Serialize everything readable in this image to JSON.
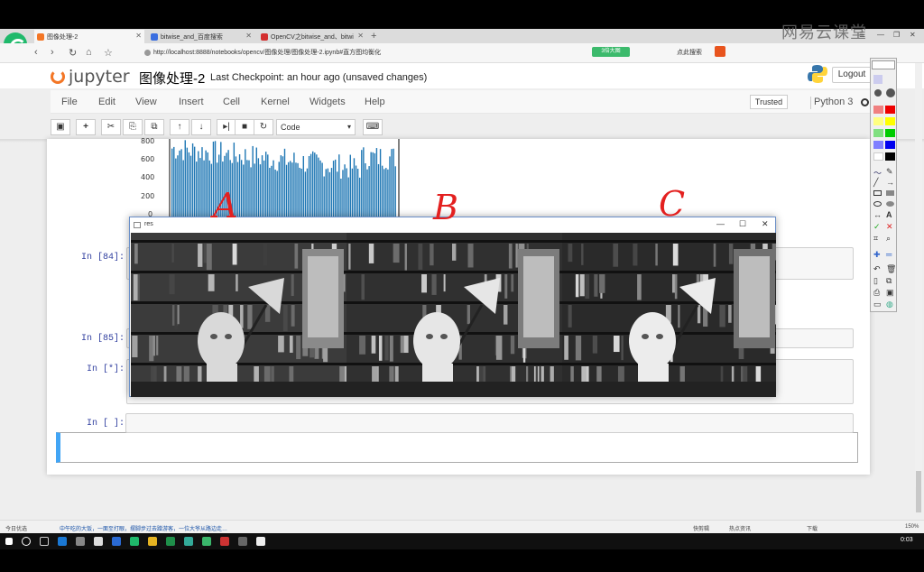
{
  "browser": {
    "tabs": [
      {
        "label": "图像处理-2",
        "active": true
      },
      {
        "label": "bitwise_and_百度搜索",
        "active": false
      },
      {
        "label": "OpenCV之bitwise_and、bitwi",
        "active": false
      }
    ],
    "url": "http://localhost:8888/notebooks/opencv/图像处理/图像处理-2.ipynb#直方图均衡化",
    "ext_badge": "3倍大图",
    "ext_search": "点此搜索",
    "watermark": "网易云课堂"
  },
  "jupyter": {
    "logo_text": "jupyter",
    "notebook_name": "图像处理-2",
    "checkpoint": "Last Checkpoint: an hour ago (unsaved changes)",
    "logout": "Logout",
    "trusted": "Trusted",
    "kernel": "Python 3",
    "menu": [
      "File",
      "Edit",
      "View",
      "Insert",
      "Cell",
      "Kernel",
      "Widgets",
      "Help"
    ],
    "cell_type": "Code",
    "toolbar_icons": [
      "save-icon",
      "plus-icon",
      "cut-icon",
      "copy-icon",
      "paste-icon",
      "arrow-up-icon",
      "arrow-down-icon",
      "run-icon",
      "stop-icon",
      "restart-icon",
      "keyboard-icon"
    ],
    "prompts": [
      "In [84]:",
      "In [85]:",
      "In [*]:",
      "In [ ]:"
    ],
    "hist_ticks": [
      "800",
      "600",
      "400",
      "200",
      "0"
    ]
  },
  "cv_window": {
    "title": "res",
    "controls": [
      "—",
      "☐",
      "✕"
    ]
  },
  "annotations": [
    "A",
    "B",
    "C"
  ],
  "statusbar": {
    "left": "今日优选",
    "news": "中午吃的大饭，一面至打眼，摆脚步过去蹭游客，一位大爷从路边走…",
    "right": [
      "快剪辑",
      "热点资讯",
      "下载",
      "150%"
    ]
  },
  "taskbar": {
    "time": "0:03"
  }
}
